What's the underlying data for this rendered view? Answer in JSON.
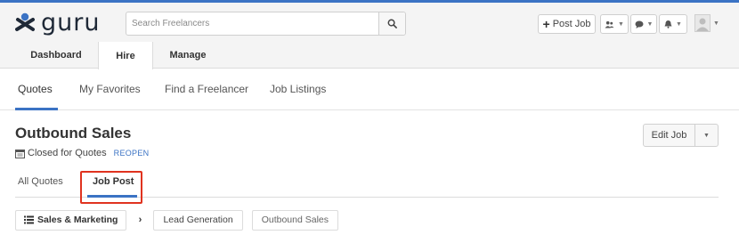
{
  "app": {
    "logo_text": "guru",
    "accent_color": "#3b73c4",
    "highlight_color": "#e0331f"
  },
  "search": {
    "placeholder": "Search Freelancers",
    "icon": "search-icon"
  },
  "header_actions": {
    "post_job_label": "Post Job",
    "icons": [
      "contacts-icon",
      "chat-icon",
      "bell-icon",
      "avatar"
    ]
  },
  "main_tabs": [
    {
      "label": "Dashboard"
    },
    {
      "label": "Hire",
      "active": true
    },
    {
      "label": "Manage"
    }
  ],
  "subnav": [
    {
      "label": "Quotes",
      "active": true
    },
    {
      "label": "My Favorites"
    },
    {
      "label": "Find a Freelancer"
    },
    {
      "label": "Job Listings"
    }
  ],
  "job": {
    "title": "Outbound Sales",
    "status": "Closed for Quotes",
    "reopen_label": "REOPEN",
    "edit_label": "Edit Job"
  },
  "quote_tabs": [
    {
      "label": "All Quotes"
    },
    {
      "label": "Job Post",
      "active": true
    }
  ],
  "breadcrumbs": [
    "Sales & Marketing",
    "Lead Generation",
    "Outbound Sales"
  ]
}
